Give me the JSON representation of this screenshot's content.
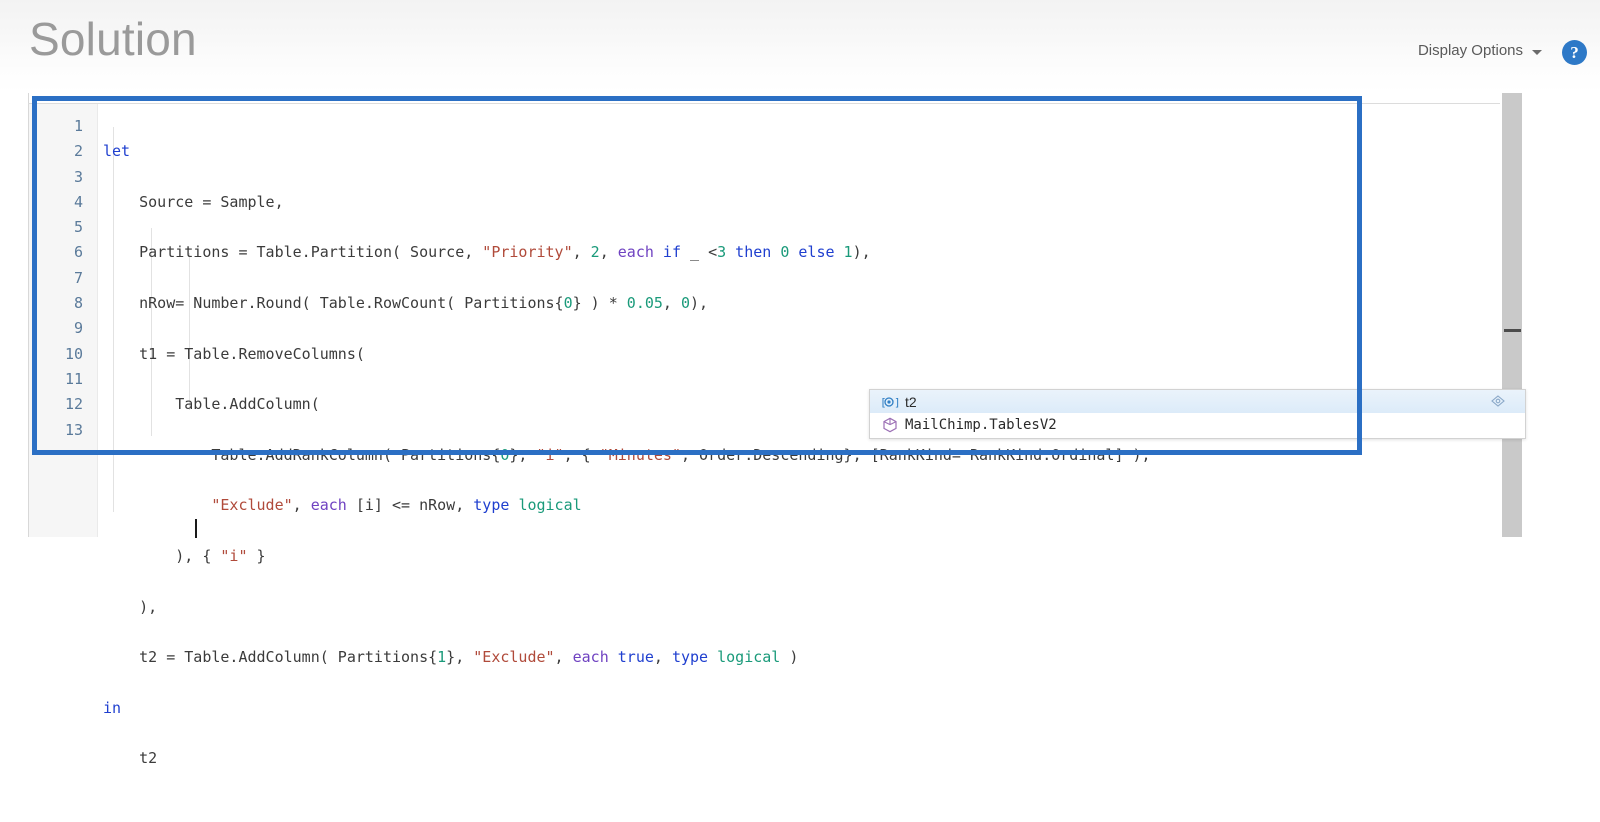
{
  "header": {
    "title": "Solution",
    "display_options_label": "Display Options",
    "help_icon": "help-circle-icon",
    "caret_icon": "chevron-down-icon"
  },
  "editor": {
    "line_numbers": [
      "1",
      "2",
      "3",
      "4",
      "5",
      "6",
      "7",
      "8",
      "9",
      "10",
      "11",
      "12",
      "13"
    ],
    "lines": [
      "let",
      "    Source = Sample,",
      "    Partitions = Table.Partition( Source, \"Priority\", 2, each if _ <3 then 0 else 1),",
      "    nRow= Number.Round( Table.RowCount( Partitions{0} ) * 0.05, 0),",
      "    t1 = Table.RemoveColumns(",
      "        Table.AddColumn(",
      "            Table.AddRankColumn( Partitions{0}, \"i\", { \"Minutes\", Order.Descending}, [RankKind= RankKind.Ordinal] ),",
      "            \"Exclude\", each [i] <= nRow, type logical",
      "        ), { \"i\" }",
      "    ),",
      "    t2 = Table.AddColumn( Partitions{1}, \"Exclude\", each true, type logical )",
      "in",
      "    t2"
    ],
    "cursor_line": "13",
    "cursor_text": "t2"
  },
  "autocomplete": {
    "items": [
      {
        "label": "t2",
        "icon": "local-variable-icon",
        "selected": true
      },
      {
        "label": "MailChimp.TablesV2",
        "icon": "data-source-cube-icon",
        "selected": false
      }
    ],
    "expand_icon": "diamond-expand-icon"
  },
  "annotation": {
    "highlight_color": "#2b6fc4"
  },
  "scrollbar": {
    "vertical": "vertical-scrollbar"
  },
  "colors": {
    "keyword": "#1f3fcf",
    "string": "#b04a3a",
    "number": "#1a9a7a",
    "each_keyword": "#6f42c1",
    "type": "#1a9a7a",
    "title": "#9a9a9a",
    "help_blue": "#2e79c7"
  }
}
